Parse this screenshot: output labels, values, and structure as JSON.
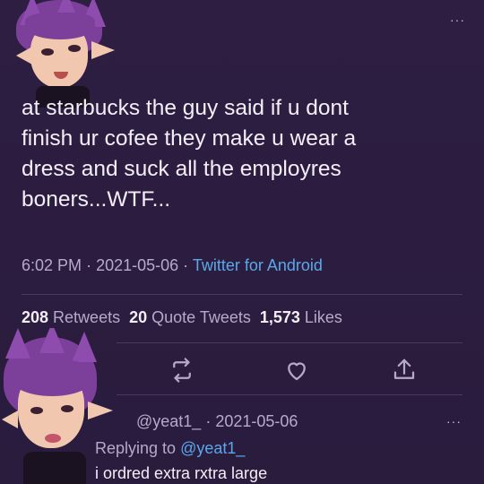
{
  "tweet": {
    "text": "at starbucks the guy said if u  dont\nfinish ur cofee they make u wear a\ndress and suck all the employres\nboners...WTF...",
    "time": "6:02 PM",
    "date": "2021-05-06",
    "source": "Twitter for Android",
    "separator": "·"
  },
  "stats": {
    "retweets_count": "208",
    "retweets_label": "Retweets",
    "quotes_count": "20",
    "quotes_label": "Quote Tweets",
    "likes_count": "1,573",
    "likes_label": "Likes"
  },
  "reply": {
    "handle": "@yeat1_",
    "date": "2021-05-06",
    "replying_label": "Replying to",
    "replying_handle": "@yeat1_",
    "text": "i ordred extra rxtra large"
  },
  "menu": {
    "dots": "···"
  },
  "colors": {
    "background": "#2b1d3f",
    "link": "#5aa8ea",
    "muted": "#b6aacb",
    "text": "#f3eef8"
  },
  "icons": {
    "retweet": "retweet-icon",
    "like": "heart-icon",
    "share": "share-icon",
    "more": "more-icon"
  }
}
